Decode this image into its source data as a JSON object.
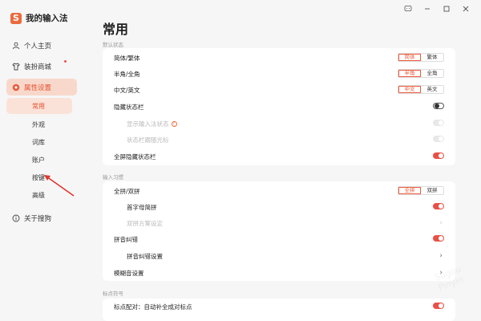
{
  "app": {
    "name": "我的输入法",
    "page_title": "常用"
  },
  "colors": {
    "accent": "#ec5a3a",
    "toggle_on": "#ea4f45",
    "nav_active_bg": "#f9d8cc"
  },
  "sidebar": {
    "items": [
      {
        "label": "个人主页",
        "icon": "user-icon"
      },
      {
        "label": "装扮商城",
        "icon": "shirt-icon"
      },
      {
        "label": "属性设置",
        "icon": "settings-icon"
      },
      {
        "label": "关于搜狗",
        "icon": "info-icon"
      }
    ],
    "sub_items": [
      {
        "label": "常用"
      },
      {
        "label": "外观"
      },
      {
        "label": "词库"
      },
      {
        "label": "账户"
      },
      {
        "label": "按键"
      },
      {
        "label": "高级"
      }
    ]
  },
  "sections": {
    "default_state": {
      "label": "默认状态",
      "rows": {
        "charset": {
          "label": "简体/繁体",
          "opt_a": "简体",
          "opt_b": "繁体"
        },
        "width": {
          "label": "半角/全角",
          "opt_a": "半角",
          "opt_b": "全角"
        },
        "lang": {
          "label": "中文/英文",
          "opt_a": "中文",
          "opt_b": "英文"
        },
        "hide_status": {
          "label": "隐藏状态栏"
        },
        "show_input_status": {
          "label": "显示输入法状态"
        },
        "status_follow": {
          "label": "状态栏跟随光标"
        },
        "fullscreen_hide": {
          "label": "全屏隐藏状态栏"
        }
      }
    },
    "input_habits": {
      "label": "输入习惯",
      "rows": {
        "pinyin_mode": {
          "label": "全拼/双拼",
          "opt_a": "全拼",
          "opt_b": "双拼"
        },
        "initials": {
          "label": "首字母简拼"
        },
        "shuangpin_scheme": {
          "label": "双拼方案设定"
        },
        "pinyin_correct": {
          "label": "拼音纠错"
        },
        "pinyin_correct_settings": {
          "label": "拼音纠错设置"
        },
        "fuzzy": {
          "label": "模糊音设置"
        }
      }
    },
    "punctuation": {
      "label": "标点符号",
      "rows": {
        "auto_pair": {
          "label": "标点配对：自动补全成对标点"
        }
      }
    }
  },
  "watermark": "Sogou Pinyin"
}
